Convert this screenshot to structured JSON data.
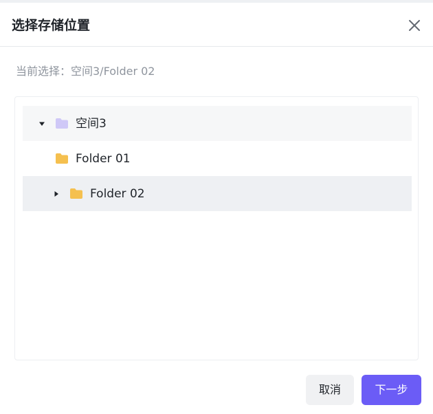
{
  "dialog": {
    "title": "选择存储位置",
    "current_selection": "当前选择：空间3/Folder 02"
  },
  "tree": {
    "items": [
      {
        "label": "空间3",
        "icon": "space-icon",
        "expanded": true
      },
      {
        "label": "Folder 01",
        "icon": "folder-icon"
      },
      {
        "label": "Folder 02",
        "icon": "folder-icon",
        "expanded": false,
        "selected": true
      }
    ]
  },
  "buttons": {
    "cancel": "取消",
    "next": "下一步"
  },
  "colors": {
    "primary": "#6b5cf6",
    "folder": "#f5c04f",
    "space_icon": "#cfc8f7",
    "selected_row": "#eef0f3"
  }
}
